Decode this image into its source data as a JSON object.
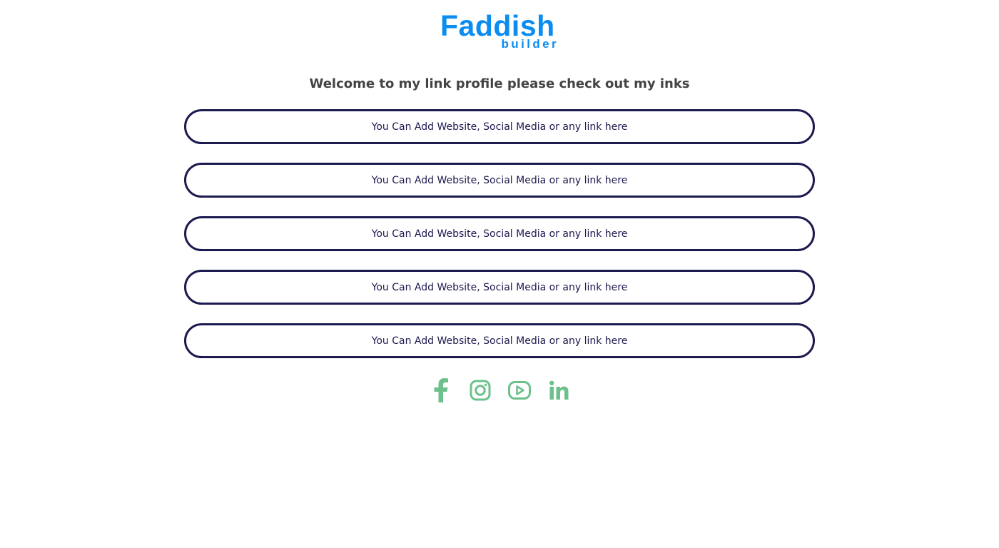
{
  "brand": {
    "name": "Faddish",
    "tagline": "builder",
    "color": "#0a8cf0"
  },
  "welcome_text": "Welcome to my link profile please check out my inks",
  "links": [
    {
      "label": "You Can Add Website, Social Media or any link here"
    },
    {
      "label": "You Can Add Website, Social Media or any link here"
    },
    {
      "label": "You Can Add Website, Social Media or any link here"
    },
    {
      "label": "You Can Add Website, Social Media or any link here"
    },
    {
      "label": "You Can Add Website, Social Media or any link here"
    }
  ],
  "link_border_color": "#1d1a4f",
  "social": {
    "icon_color": "#6cc18b",
    "icons": [
      "facebook-icon",
      "instagram-icon",
      "youtube-icon",
      "linkedin-icon"
    ]
  }
}
